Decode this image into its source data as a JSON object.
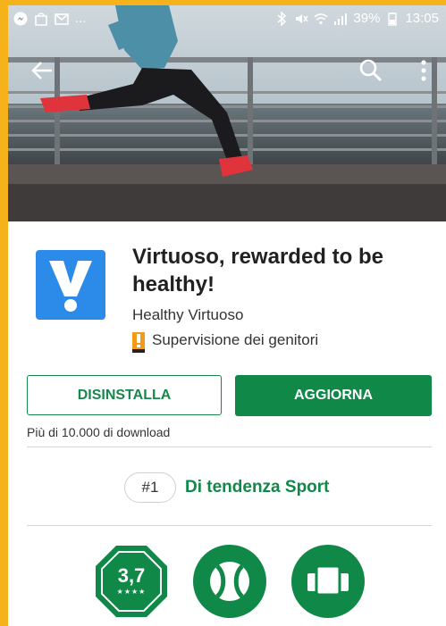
{
  "status_bar": {
    "time": "13:05",
    "battery": "39%",
    "left_icons": [
      "messenger-icon",
      "shopping-bag-icon",
      "gmail-icon"
    ],
    "overflow": "..."
  },
  "app": {
    "title": "Virtuoso, rewarded to be healthy!",
    "developer": "Healthy Virtuoso",
    "content_rating": "Supervisione dei genitori",
    "icon_color": "#2c8ae8"
  },
  "actions": {
    "uninstall": "DISINSTALLA",
    "update": "AGGIORNA"
  },
  "downloads": "Più di 10.000 di download",
  "trending": {
    "rank": "#1",
    "label": "Di tendenza Sport"
  },
  "badges": {
    "score": "3,7",
    "stars": "★★★★",
    "sport_icon": "tennis-ball-icon",
    "category_icon": "cards-icon"
  },
  "colors": {
    "accent": "#0f8848",
    "frame": "#f5b21a"
  }
}
